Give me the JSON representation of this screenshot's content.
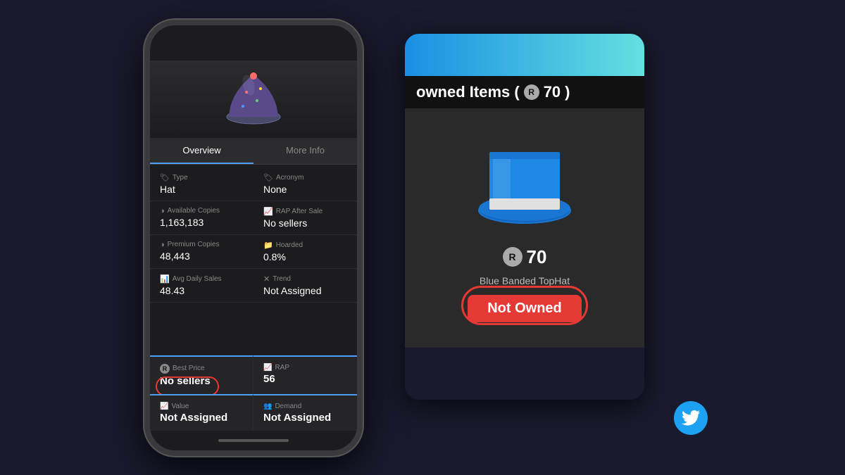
{
  "phone": {
    "tabs": [
      {
        "label": "Overview",
        "active": true
      },
      {
        "label": "More Info",
        "active": false
      }
    ],
    "info_rows": [
      {
        "left": {
          "label": "Type",
          "icon": "🏷",
          "value": "Hat"
        },
        "right": {
          "label": "Acronym",
          "icon": "🏷",
          "value": "None"
        }
      },
      {
        "left": {
          "label": "Available Copies",
          "icon": "◑",
          "value": "1,163,183"
        },
        "right": {
          "label": "RAP After Sale",
          "icon": "📈",
          "value": "No sellers"
        }
      },
      {
        "left": {
          "label": "Premium Copies",
          "icon": "◑",
          "value": "48,443"
        },
        "right": {
          "label": "Hoarded",
          "icon": "📁",
          "value": "0.8%"
        }
      },
      {
        "left": {
          "label": "Avg Daily Sales",
          "icon": "📊",
          "value": "48.43"
        },
        "right": {
          "label": "Trend",
          "icon": "✕",
          "value": "Not Assigned"
        }
      }
    ],
    "bottom_cards": [
      {
        "label": "Best Price",
        "icon": "⊙",
        "value": "No sellers",
        "highlighted": true
      },
      {
        "label": "RAP",
        "icon": "📈",
        "value": "56"
      },
      {
        "label": "Value",
        "icon": "📈",
        "value": "Not Assigned"
      },
      {
        "label": "Demand",
        "icon": "👥",
        "value": "Not Assigned"
      }
    ]
  },
  "right_panel": {
    "top_gradient_colors": [
      "#1a8fe3",
      "#64e0e0"
    ],
    "owned_items_title": "owned Items (⊙70)",
    "owned_label": "owned Items",
    "robux_amount": "70",
    "item_price": "70",
    "item_name": "Blue Banded TopHat",
    "not_owned_label": "Not Owned",
    "card_background": "#111"
  },
  "twitter_bird": "🐦"
}
